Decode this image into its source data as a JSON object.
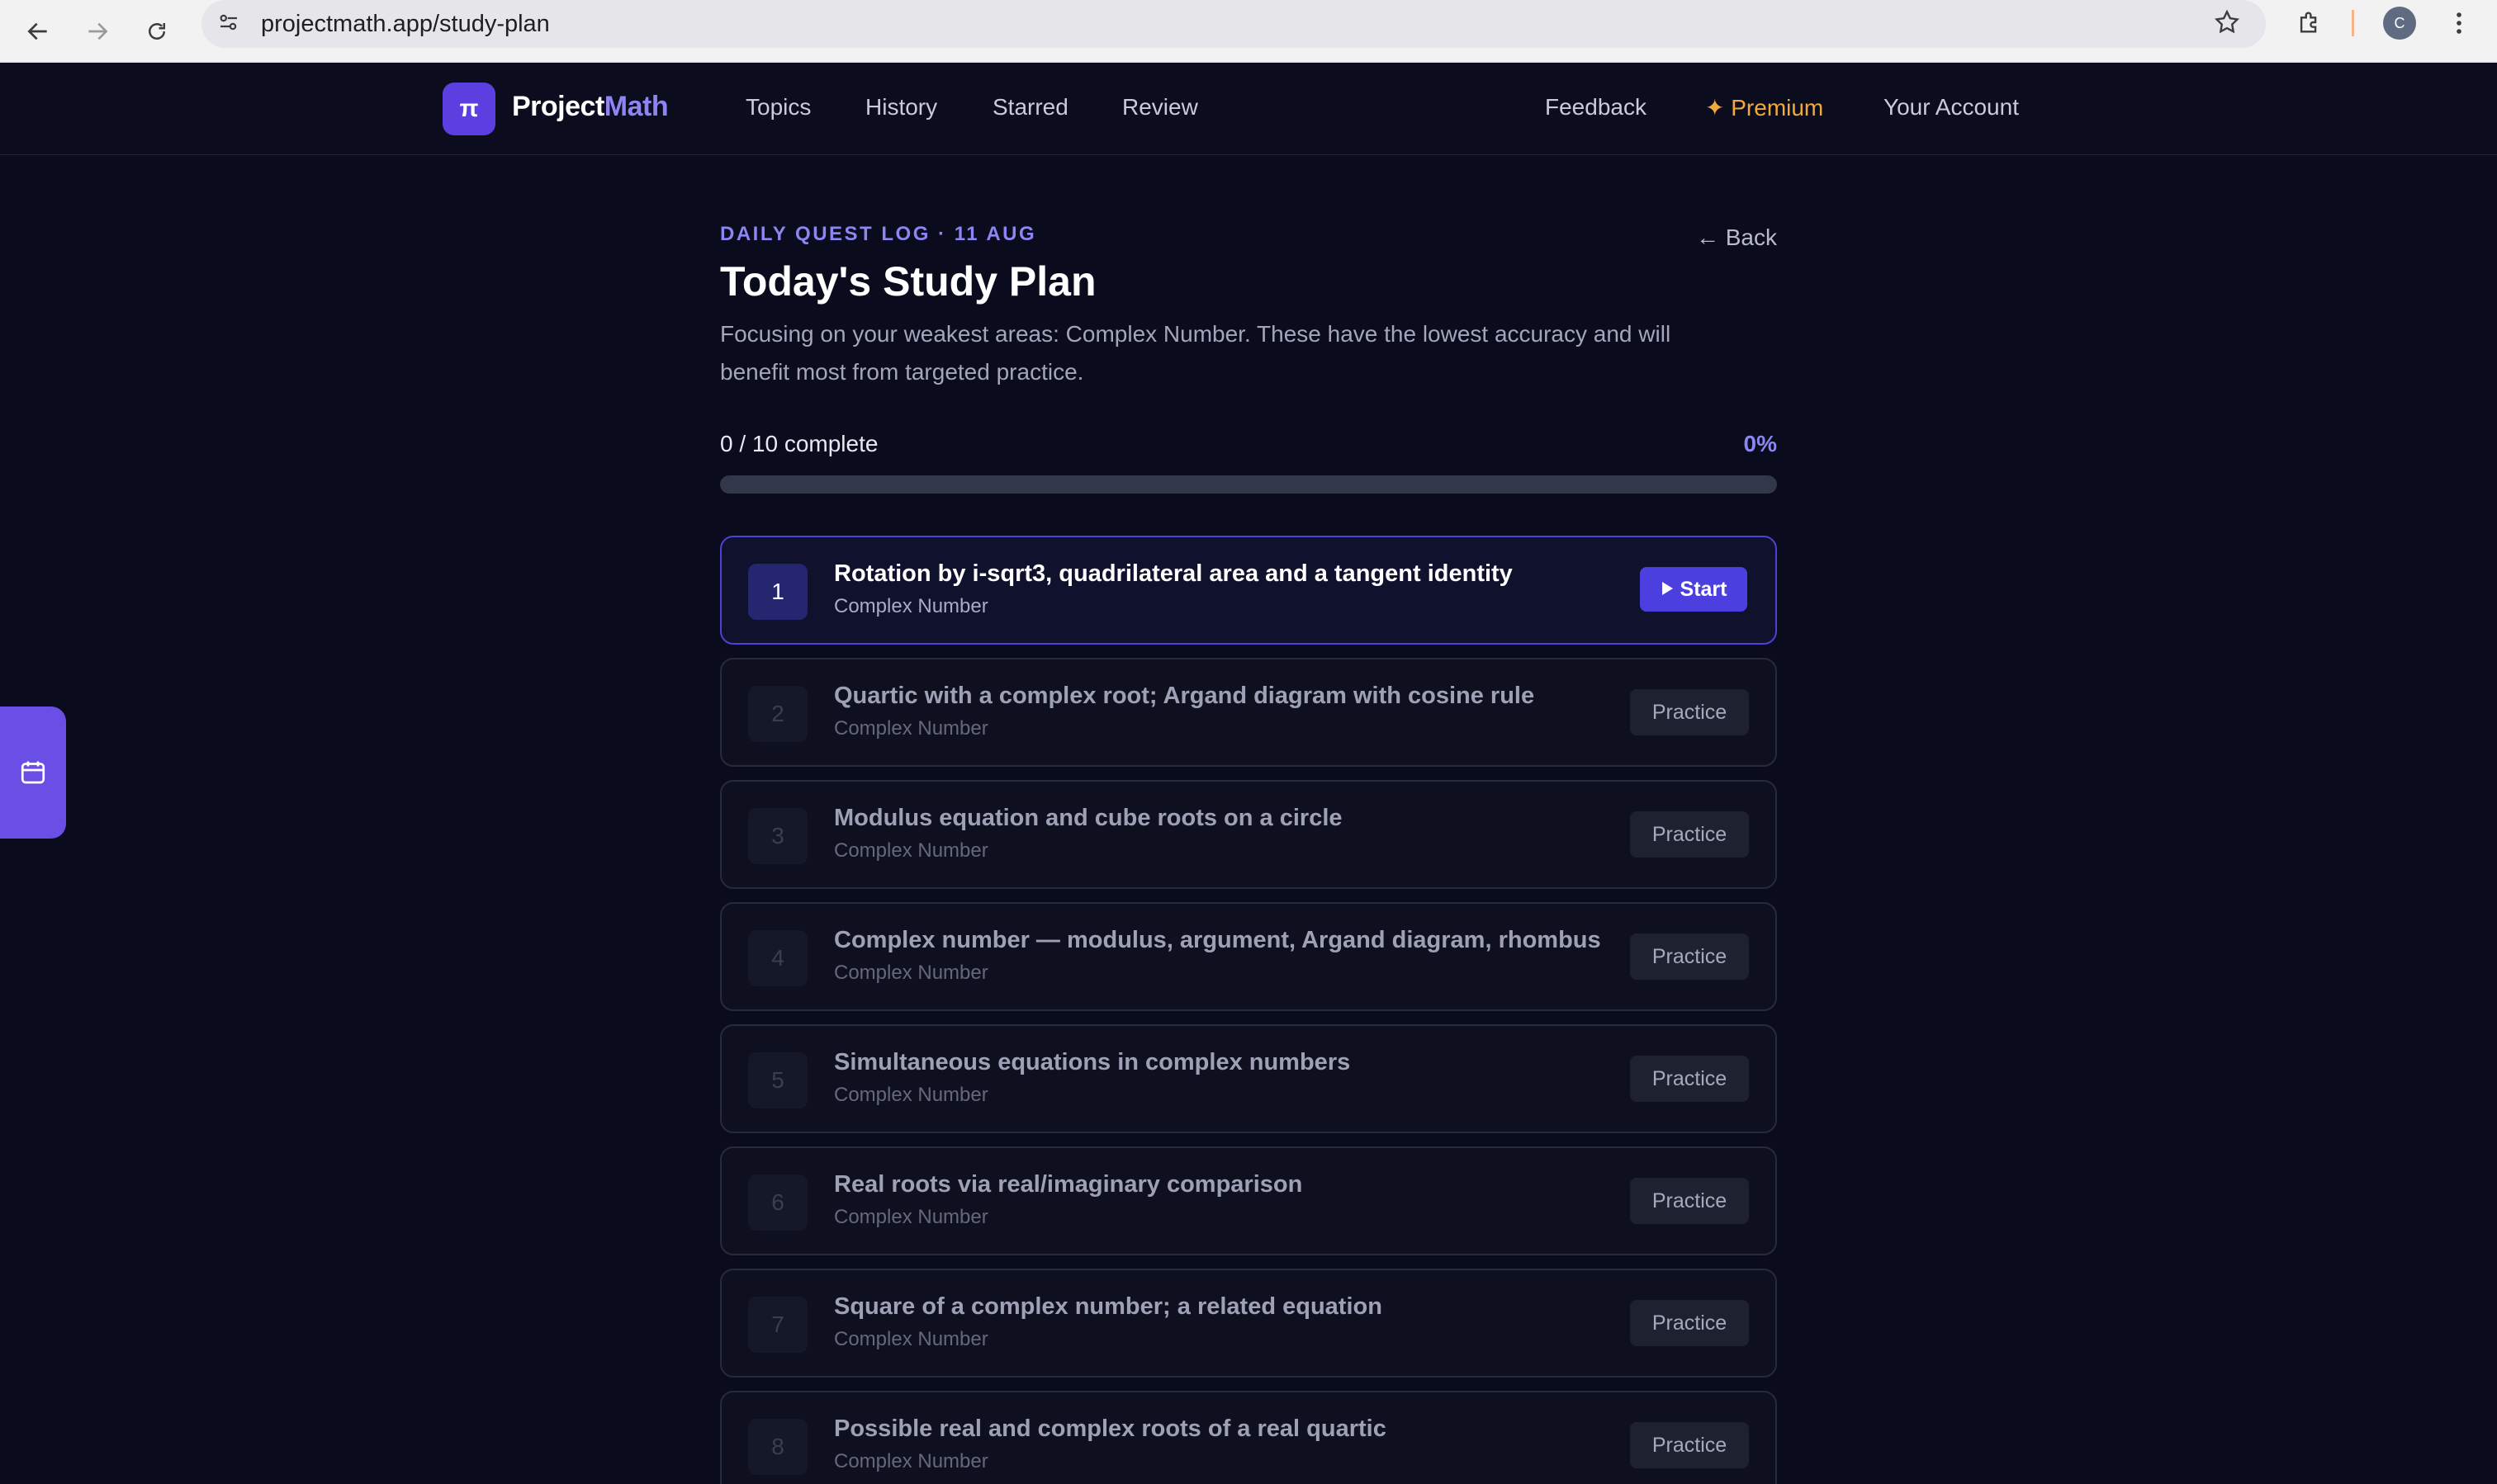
{
  "browser": {
    "url": "projectmath.app/study-plan",
    "profile_initial": "C"
  },
  "nav": {
    "logo_symbol": "π",
    "brand_part1": "Project",
    "brand_part2": "Math",
    "links": [
      "Topics",
      "History",
      "Starred",
      "Review"
    ],
    "feedback": "Feedback",
    "premium": "✦ Premium",
    "account": "Your Account"
  },
  "page": {
    "eyebrow": "DAILY QUEST LOG · 11 AUG",
    "back_label": "← Back",
    "title": "Today's Study Plan",
    "subtitle": "Focusing on your weakest areas: Complex Number. These have the lowest accuracy and will benefit most from targeted practice.",
    "progress_label": "0 / 10 complete",
    "progress_percent_label": "0%",
    "progress_value": 0
  },
  "tasks": [
    {
      "num": "1",
      "title": "Rotation by i-sqrt3, quadrilateral area and a tangent identity",
      "topic": "Complex Number",
      "action": "Start",
      "active": true
    },
    {
      "num": "2",
      "title": "Quartic with a complex root; Argand diagram with cosine rule",
      "topic": "Complex Number",
      "action": "Practice",
      "active": false
    },
    {
      "num": "3",
      "title": "Modulus equation and cube roots on a circle",
      "topic": "Complex Number",
      "action": "Practice",
      "active": false
    },
    {
      "num": "4",
      "title": "Complex number — modulus, argument, Argand diagram, rhombus",
      "topic": "Complex Number",
      "action": "Practice",
      "active": false
    },
    {
      "num": "5",
      "title": "Simultaneous equations in complex numbers",
      "topic": "Complex Number",
      "action": "Practice",
      "active": false
    },
    {
      "num": "6",
      "title": "Real roots via real/imaginary comparison",
      "topic": "Complex Number",
      "action": "Practice",
      "active": false
    },
    {
      "num": "7",
      "title": "Square of a complex number; a related equation",
      "topic": "Complex Number",
      "action": "Practice",
      "active": false
    },
    {
      "num": "8",
      "title": "Possible real and complex roots of a real quartic",
      "topic": "Complex Number",
      "action": "Practice",
      "active": false
    }
  ],
  "colors": {
    "accent": "#5b3fe0",
    "accent_text": "#8b86f2",
    "premium": "#f2a93b",
    "background": "#0a0b1c"
  }
}
